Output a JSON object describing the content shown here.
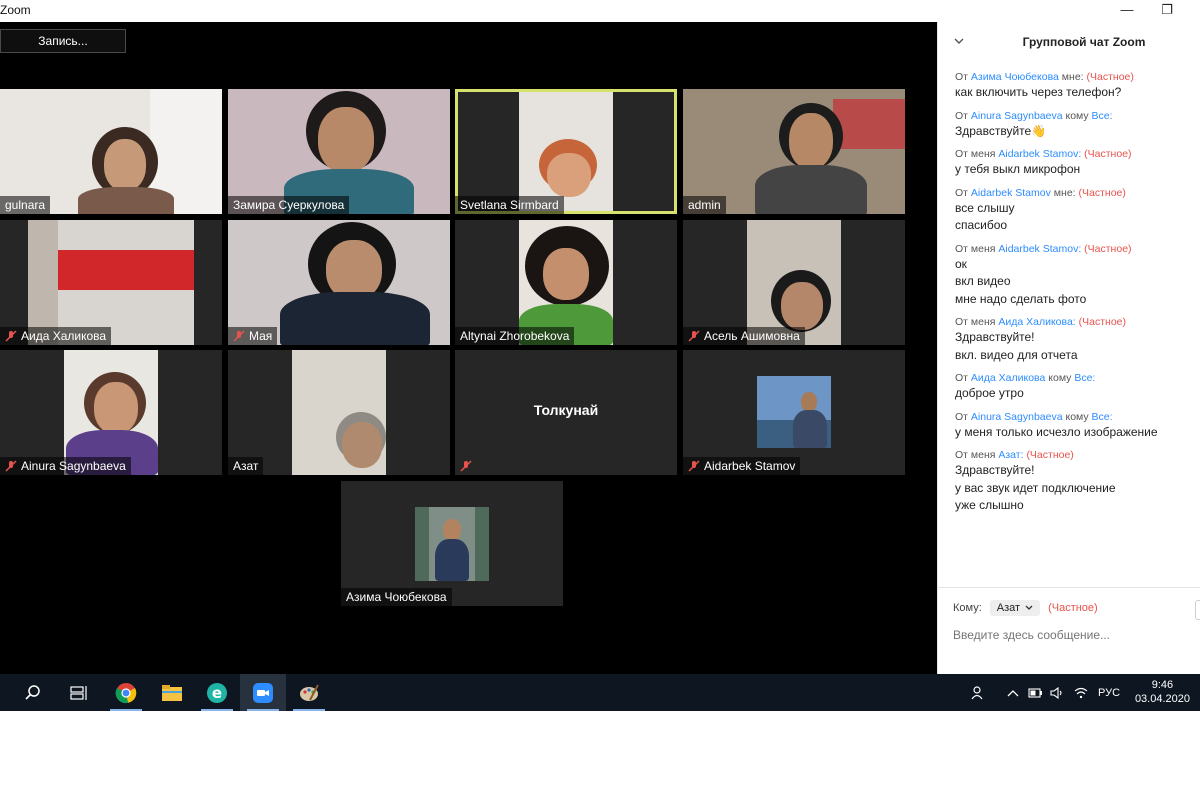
{
  "window": {
    "title": "Zoom",
    "minimize": "—",
    "restore": "❐"
  },
  "toolbar": {
    "record_label": "Запись..."
  },
  "tiles": [
    {
      "name": "gulnara",
      "muted": false
    },
    {
      "name": "Замира Суеркулова",
      "muted": false
    },
    {
      "name": "Svetlana Sirmbard",
      "muted": false,
      "active": true
    },
    {
      "name": "admin",
      "muted": false
    },
    {
      "name": "Аида Халикова",
      "muted": true
    },
    {
      "name": "Мая",
      "muted": true
    },
    {
      "name": "Altynai Zhorobekova",
      "muted": false
    },
    {
      "name": "Асель Ашимовна",
      "muted": true
    },
    {
      "name": "Ainura Sagynbaeva",
      "muted": true
    },
    {
      "name": "Азат",
      "muted": false
    },
    {
      "name": "Толкунай",
      "muted": true,
      "video_off": true
    },
    {
      "name": "Aidarbek Stamov",
      "muted": true
    },
    {
      "name": "Азима Чоюбекова",
      "muted": false
    }
  ],
  "chat": {
    "title": "Групповой чат Zoom",
    "messages": [
      {
        "from_prefix": "От",
        "from": "Азима Чоюбекова",
        "to_prefix": "мне:",
        "to": "",
        "tag": "(Частное)",
        "lines": [
          "как включить через телефон?"
        ]
      },
      {
        "from_prefix": "От",
        "from": "Ainura Sagynbaeva",
        "to_prefix": "кому",
        "to": "Все:",
        "tag": "",
        "lines": [
          "Здравствуйте👋"
        ]
      },
      {
        "from_prefix": "От меня",
        "from": "Aidarbek Stamov:",
        "to_prefix": "",
        "to": "",
        "tag": "(Частное)",
        "lines": [
          "у тебя выкл микрофон"
        ]
      },
      {
        "from_prefix": "От",
        "from": "Aidarbek Stamov",
        "to_prefix": "мне:",
        "to": "",
        "tag": "(Частное)",
        "lines": [
          "все слышу",
          "спасибоо"
        ]
      },
      {
        "from_prefix": "От меня",
        "from": "Aidarbek Stamov:",
        "to_prefix": "",
        "to": "",
        "tag": "(Частное)",
        "lines": [
          "ок",
          "вкл видео",
          "мне надо сделать фото"
        ]
      },
      {
        "from_prefix": "От меня",
        "from": "Аида Халикова:",
        "to_prefix": "",
        "to": "",
        "tag": "(Частное)",
        "lines": [
          "Здравствуйте!",
          "вкл. видео для отчета"
        ]
      },
      {
        "from_prefix": "От",
        "from": "Аида Халикова",
        "to_prefix": "кому",
        "to": "Все:",
        "tag": "",
        "lines": [
          "доброе утро"
        ]
      },
      {
        "from_prefix": "От",
        "from": "Ainura Sagynbaeva",
        "to_prefix": "кому",
        "to": "Все:",
        "tag": "",
        "lines": [
          "у меня только исчезло изображение"
        ]
      },
      {
        "from_prefix": "От меня",
        "from": "Азат:",
        "to_prefix": "",
        "to": "",
        "tag": "(Частное)",
        "lines": [
          "Здравствуйте!",
          "у вас звук идет подключение",
          "уже слышно"
        ]
      }
    ],
    "to_label": "Кому:",
    "to_value": "Азат",
    "to_tag": "(Частное)",
    "input_placeholder": "Введите здесь сообщение..."
  },
  "taskbar": {
    "tray_lang": "РУС",
    "time": "9:46",
    "date": "03.04.2020"
  },
  "colors": {
    "active_speaker": "#d6e26b",
    "link": "#2d8cff",
    "private": "#e8534d",
    "taskbar": "#0e1621"
  }
}
